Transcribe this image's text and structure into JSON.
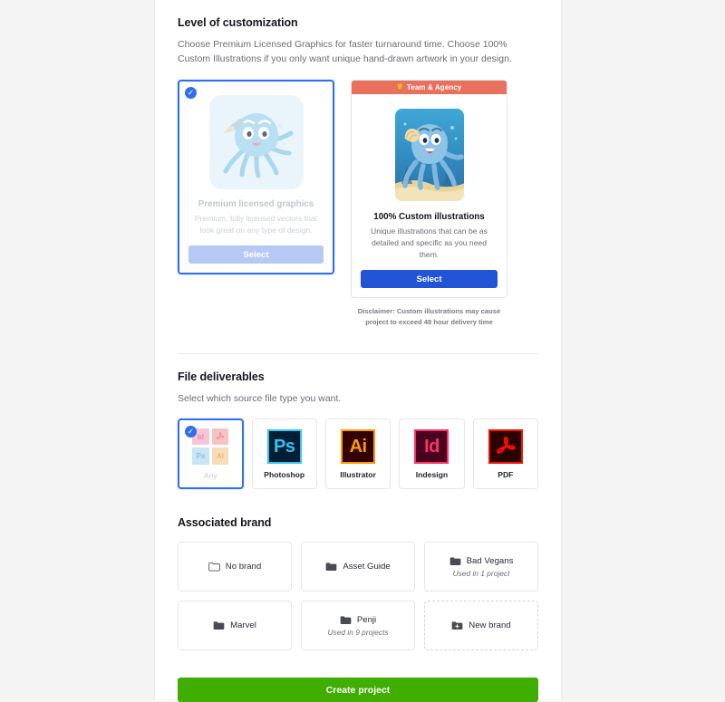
{
  "customization": {
    "title": "Level of customization",
    "subtitle": "Choose Premium Licensed Graphics for faster turnaround time. Choose 100% Custom Illustrations if you only want unique hand-drawn artwork in your design.",
    "options": [
      {
        "name": "Premium licensed graphics",
        "description": "Premium, fully licensed vectors that look great on any type of design.",
        "select_label": "Select",
        "selected": true,
        "badge": null
      },
      {
        "name": "100% Custom illustrations",
        "description": "Unique illustrations that can be as detailed and specific as you need them.",
        "select_label": "Select",
        "selected": false,
        "badge": "Team & Agency"
      }
    ],
    "disclaimer": "Disclaimer: Custom illustrations may cause project to exceed 48 hour delivery time"
  },
  "deliverables": {
    "title": "File deliverables",
    "subtitle": "Select which source file type you want.",
    "options": [
      {
        "label": "Any",
        "icon": "any-grid-icon",
        "selected": true
      },
      {
        "label": "Photoshop",
        "icon": "photoshop-icon",
        "glyph": "Ps",
        "bg": "#001E36",
        "border": "#31C5F0",
        "fg": "#31C5F0",
        "selected": false
      },
      {
        "label": "Illustrator",
        "icon": "illustrator-icon",
        "glyph": "Ai",
        "bg": "#330000",
        "border": "#FF9A00",
        "fg": "#FF9A00",
        "selected": false
      },
      {
        "label": "Indesign",
        "icon": "indesign-icon",
        "glyph": "Id",
        "bg": "#49021F",
        "border": "#FF3366",
        "fg": "#FF3366",
        "selected": false
      },
      {
        "label": "PDF",
        "icon": "pdf-icon",
        "glyph": "",
        "bg": "#2B0000",
        "border": "#FA0F00",
        "fg": "#FA0F00",
        "selected": false
      }
    ],
    "any_tiles": [
      {
        "glyph": "Id",
        "bg": "#f5c6d6",
        "fg": "#e98aa8"
      },
      {
        "glyph": "",
        "bg": "#f6c3c3",
        "fg": "#ea9494"
      },
      {
        "glyph": "Ps",
        "bg": "#c9e4f2",
        "fg": "#94c2da"
      },
      {
        "glyph": "Ai",
        "bg": "#f6dcb9",
        "fg": "#e0b87d"
      }
    ]
  },
  "brand": {
    "title": "Associated brand",
    "items": [
      {
        "label": "No brand",
        "icon": "folder-outline-icon",
        "note": ""
      },
      {
        "label": "Asset Guide",
        "icon": "folder-icon",
        "note": ""
      },
      {
        "label": "Bad Vegans",
        "icon": "folder-icon",
        "note": "Used in 1 project"
      },
      {
        "label": "Marvel",
        "icon": "folder-icon",
        "note": ""
      },
      {
        "label": "Penji",
        "icon": "folder-icon",
        "note": "Used in 9 projects"
      },
      {
        "label": "New brand",
        "icon": "folder-plus-icon",
        "note": "",
        "dashed": true
      }
    ]
  },
  "footer": {
    "create_label": "Create project"
  },
  "colors": {
    "accent_blue": "#2f6ef0",
    "primary_blue": "#2255d6",
    "ribbon": "#e8705c",
    "create_green": "#3fae00"
  }
}
